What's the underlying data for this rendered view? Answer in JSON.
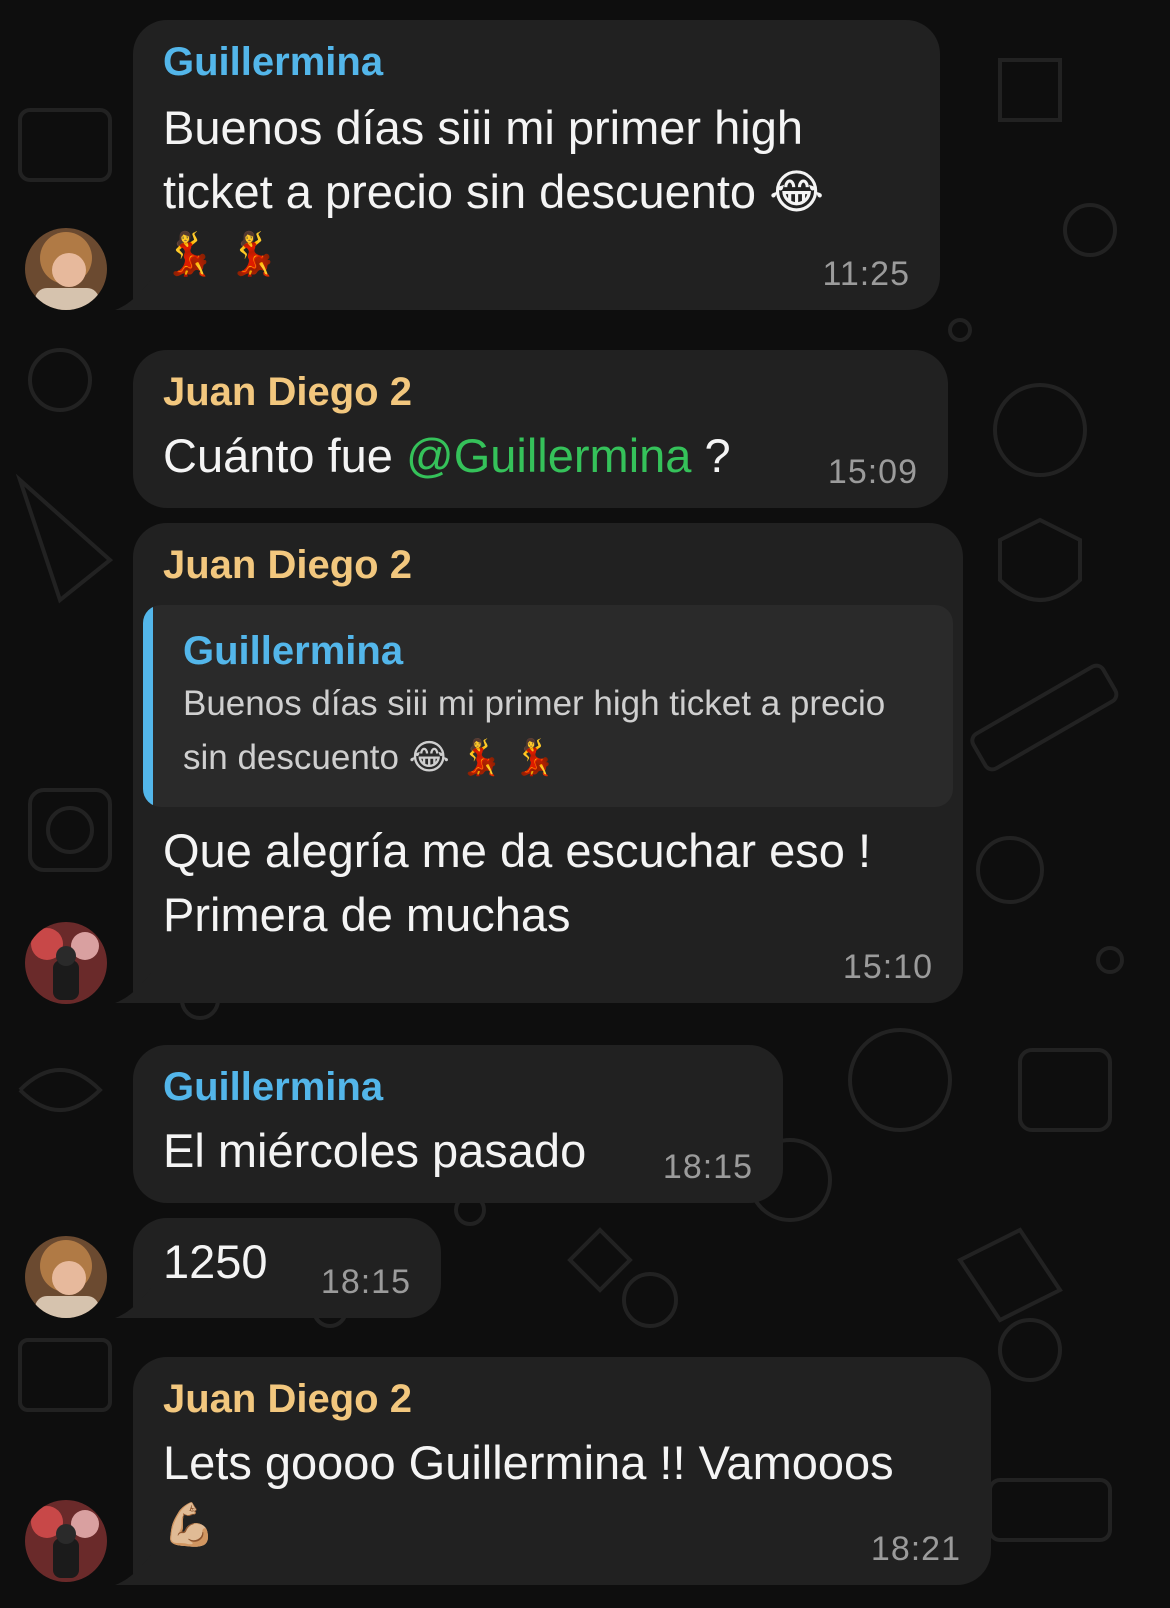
{
  "theme": {
    "background": "#0e0e0e",
    "bubble": "#212121",
    "sender_blue": "#53b6ea",
    "sender_gold": "#f2c77e",
    "mention_green": "#35c25a"
  },
  "messages": [
    {
      "sender": "Guillermina",
      "text": "Buenos días siii  mi primer high ticket  a precio sin descuento 😂",
      "emojis": "💃 💃",
      "time": "11:25"
    },
    {
      "sender": "Juan Diego 2",
      "text_before": "Cuánto fue ",
      "mention": "@Guillermina",
      "text_after": " ?",
      "time": "15:09"
    },
    {
      "sender": "Juan Diego 2",
      "reply": {
        "sender": "Guillermina",
        "text": "Buenos días siii  mi primer high ticket  a precio sin descuento 😂 💃 💃"
      },
      "text": "Que alegría me da escuchar eso ! Primera de muchas",
      "time": "15:10"
    },
    {
      "sender": "Guillermina",
      "text": "El miércoles pasado",
      "time": "18:15"
    },
    {
      "text": "1250",
      "time": "18:15"
    },
    {
      "sender": "Juan Diego 2",
      "text": "Lets goooo Guillermina !! Vamooos",
      "emojis": "💪🏼",
      "time": "18:21"
    }
  ]
}
